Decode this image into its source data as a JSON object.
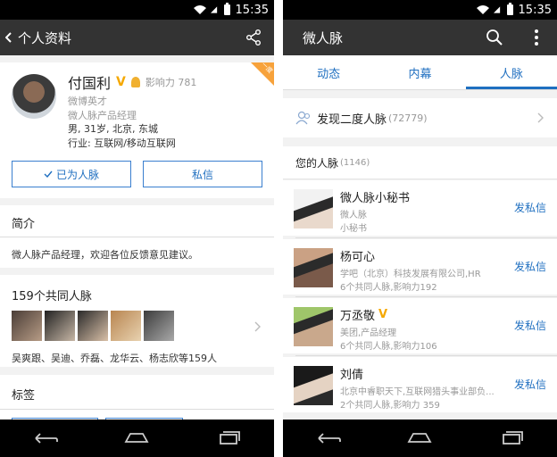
{
  "status": {
    "time": "15:35"
  },
  "left": {
    "appbar": {
      "back_title": "个人资料"
    },
    "profile": {
      "name": "付国利",
      "verified_mark": "V",
      "influence": "影响力 781",
      "title1": "微博英才",
      "title2": "微人脉产品经理",
      "info": "男, 31岁, 北京, 东城",
      "industry": "行业: 互联网/移动互联网",
      "corner_badge": "一度"
    },
    "buttons": {
      "connected": "已为人脉",
      "message": "私信"
    },
    "intro": {
      "header": "简介",
      "text": "微人脉产品经理，欢迎各位反馈意见建议。"
    },
    "mutual": {
      "header": "159个共同人脉",
      "names": "吴爽跟、吴迪、乔磊、龙华云、杨志欣等159人"
    },
    "tags": {
      "header": "标签"
    }
  },
  "right": {
    "appbar": {
      "title": "微人脉"
    },
    "tabs": [
      {
        "label": "动态"
      },
      {
        "label": "内幕"
      },
      {
        "label": "人脉",
        "active": true
      }
    ],
    "discover": {
      "label": "发现二度人脉",
      "count": "(72779)"
    },
    "section": {
      "label": "您的人脉",
      "count": "(1146)"
    },
    "contacts": [
      {
        "name": "微人脉小秘书",
        "line1": "微人脉",
        "line2": "小秘书",
        "action": "发私信",
        "verified": false
      },
      {
        "name": "杨可心",
        "line1": "学吧（北京）科技发展有限公司,HR",
        "line2": "6个共同人脉,影响力192",
        "action": "发私信",
        "verified": false
      },
      {
        "name": "万丞敬",
        "line1": "美团,产品经理",
        "line2": "6个共同人脉,影响力106",
        "action": "发私信",
        "verified": true
      },
      {
        "name": "刘倩",
        "line1": "北京中睿职天下,互联网猎头事业部负...",
        "line2": "2个共同人脉,影响力 359",
        "action": "发私信",
        "verified": false
      }
    ]
  }
}
